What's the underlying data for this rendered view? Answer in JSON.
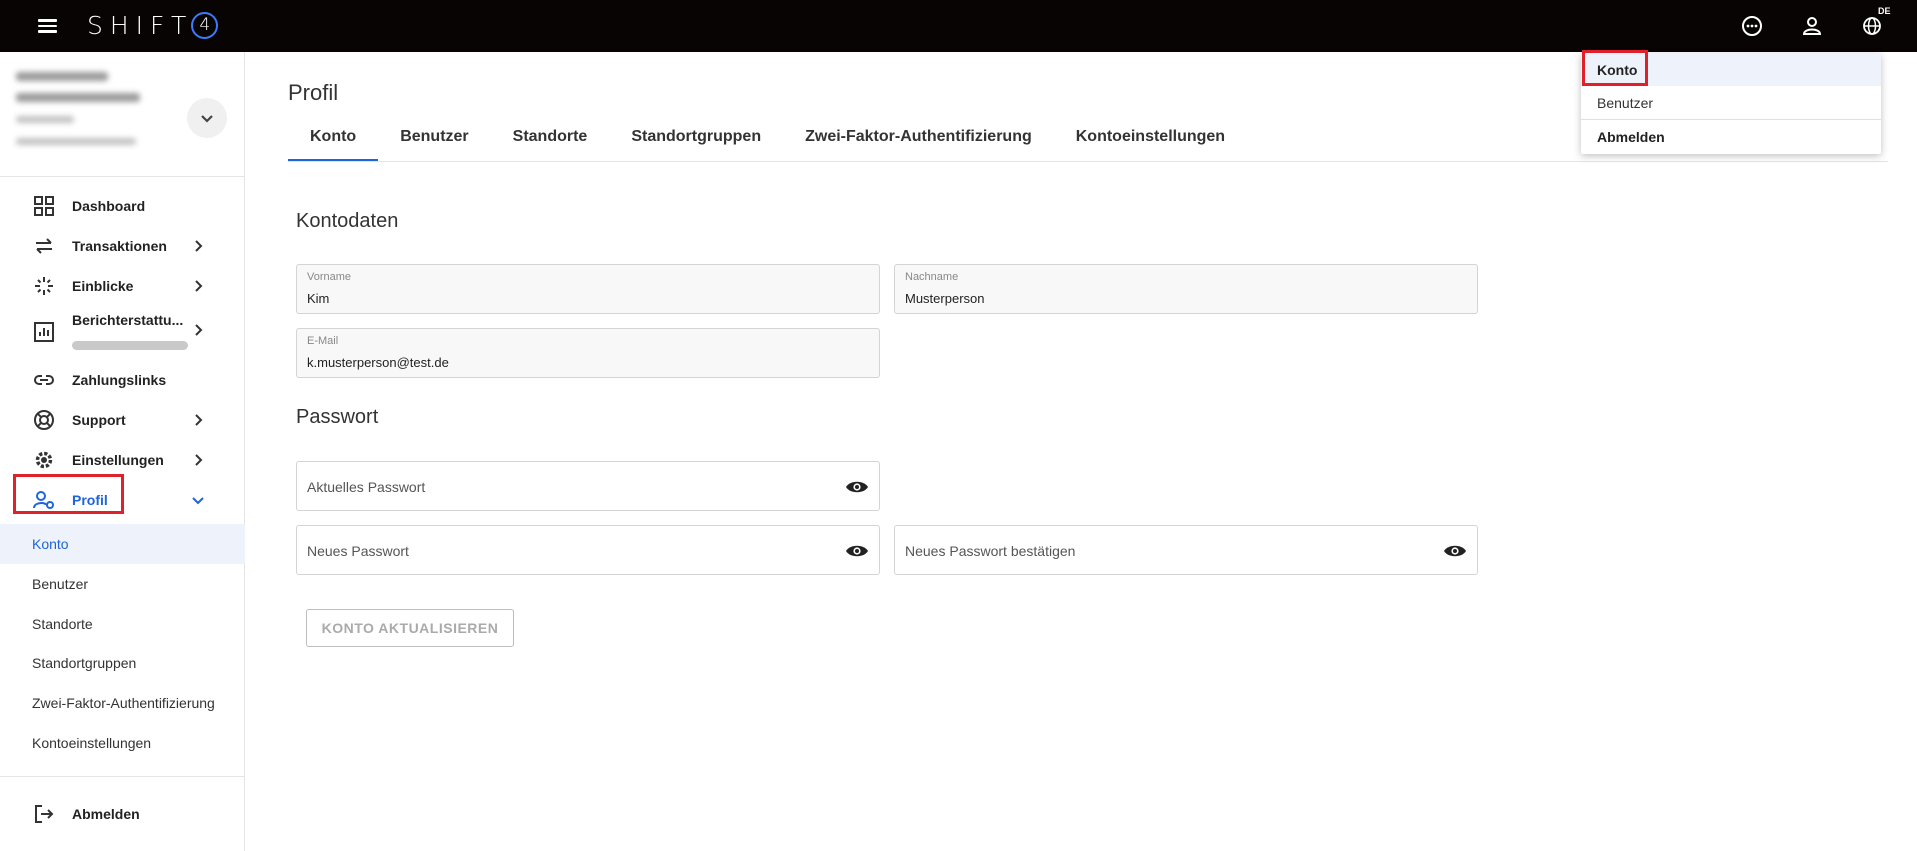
{
  "app": {
    "logo_text": "SHIFT",
    "logo_number": "4",
    "language_badge": "DE"
  },
  "sidebar": {
    "items": [
      {
        "label": "Dashboard"
      },
      {
        "label": "Transaktionen"
      },
      {
        "label": "Einblicke"
      },
      {
        "label": "Berichterstattu..."
      },
      {
        "label": "Zahlungslinks"
      },
      {
        "label": "Support"
      },
      {
        "label": "Einstellungen"
      },
      {
        "label": "Profil"
      }
    ],
    "sub_items": [
      {
        "label": "Konto"
      },
      {
        "label": "Benutzer"
      },
      {
        "label": "Standorte"
      },
      {
        "label": "Standortgruppen"
      },
      {
        "label": "Zwei-Faktor-Authentifizierung"
      },
      {
        "label": "Kontoeinstellungen"
      }
    ],
    "logout_label": "Abmelden"
  },
  "main": {
    "title": "Profil",
    "tabs": [
      {
        "label": "Konto"
      },
      {
        "label": "Benutzer"
      },
      {
        "label": "Standorte"
      },
      {
        "label": "Standortgruppen"
      },
      {
        "label": "Zwei-Faktor-Authentifizierung"
      },
      {
        "label": "Kontoeinstellungen"
      }
    ],
    "account_section": {
      "title": "Kontodaten",
      "first_name_label": "Vorname",
      "first_name_value": "Kim",
      "last_name_label": "Nachname",
      "last_name_value": "Musterperson",
      "email_label": "E-Mail",
      "email_value": "k.musterperson@test.de"
    },
    "password_section": {
      "title": "Passwort",
      "current_placeholder": "Aktuelles Passwort",
      "new_placeholder": "Neues Passwort",
      "confirm_placeholder": "Neues Passwort bestätigen"
    },
    "update_button_label": "KONTO AKTUALISIEREN"
  },
  "user_menu": {
    "items": [
      {
        "label": "Konto"
      },
      {
        "label": "Benutzer"
      },
      {
        "label": "Abmelden"
      }
    ]
  },
  "colors": {
    "accent": "#1e64dc",
    "topbar": "#080404",
    "highlight": "#e0202a"
  }
}
